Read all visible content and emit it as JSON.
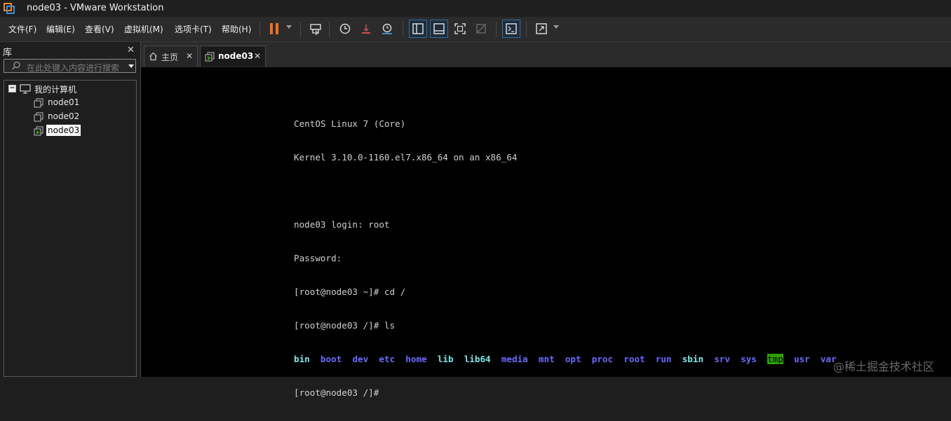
{
  "window": {
    "title": "node03 - VMware Workstation"
  },
  "menu": [
    {
      "id": "file",
      "label": "文件(F)"
    },
    {
      "id": "edit",
      "label": "编辑(E)"
    },
    {
      "id": "view",
      "label": "查看(V)"
    },
    {
      "id": "vm",
      "label": "虚拟机(M)"
    },
    {
      "id": "tabs",
      "label": "选项卡(T)"
    },
    {
      "id": "help",
      "label": "帮助(H)"
    }
  ],
  "colors": {
    "pause": "#f07020",
    "accent": "#2f6fa8",
    "tmp_bg": "#2aa000"
  },
  "library": {
    "title": "库",
    "close": "✕",
    "search_placeholder": "在此处键入内容进行搜索",
    "tree": {
      "root": "我的计算机",
      "expander": "−",
      "nodes": [
        "node01",
        "node02",
        "node03"
      ],
      "selected": "node03"
    }
  },
  "tabs": [
    {
      "id": "home",
      "label": "主页",
      "close": "✕"
    },
    {
      "id": "node03",
      "label": "node03",
      "close": "✕"
    }
  ],
  "terminal": {
    "lines": [
      "CentOS Linux 7 (Core)",
      "Kernel 3.10.0-1160.el7.x86_64 on an x86_64",
      "",
      "node03 login: root",
      "Password:",
      "[root@node03 ~]# cd /",
      "[root@node03 /]# ls"
    ],
    "ls_output": [
      {
        "name": "bin",
        "style": "cyan"
      },
      {
        "name": "boot",
        "style": "dir"
      },
      {
        "name": "dev",
        "style": "dir"
      },
      {
        "name": "etc",
        "style": "dir"
      },
      {
        "name": "home",
        "style": "dir"
      },
      {
        "name": "lib",
        "style": "cyan"
      },
      {
        "name": "lib64",
        "style": "cyan"
      },
      {
        "name": "media",
        "style": "dir"
      },
      {
        "name": "mnt",
        "style": "dir"
      },
      {
        "name": "opt",
        "style": "dir"
      },
      {
        "name": "proc",
        "style": "dir"
      },
      {
        "name": "root",
        "style": "dir"
      },
      {
        "name": "run",
        "style": "dir"
      },
      {
        "name": "sbin",
        "style": "cyan"
      },
      {
        "name": "srv",
        "style": "dir"
      },
      {
        "name": "sys",
        "style": "dir"
      },
      {
        "name": "tmp",
        "style": "tmp"
      },
      {
        "name": "usr",
        "style": "dir"
      },
      {
        "name": "var",
        "style": "dir"
      }
    ],
    "prompt": "[root@node03 /]#"
  },
  "watermark": "@稀土掘金技术社区"
}
